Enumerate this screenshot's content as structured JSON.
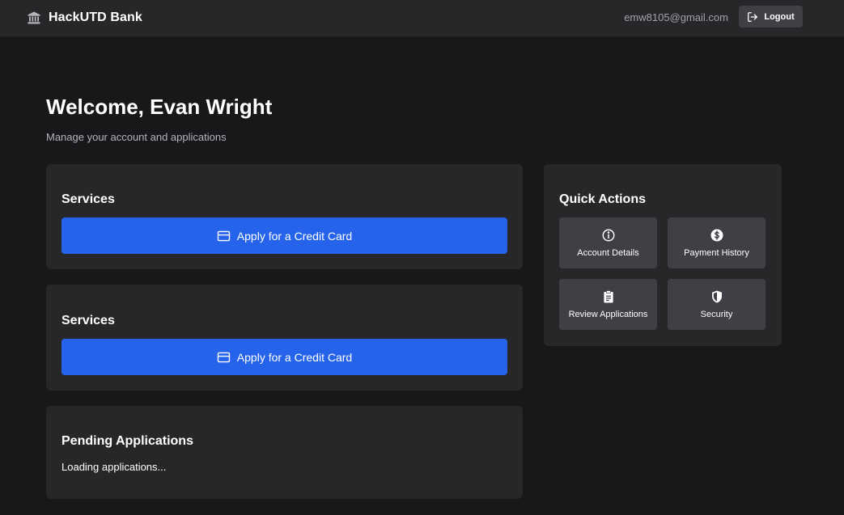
{
  "navbar": {
    "brand": "HackUTD Bank",
    "brand_icon": "bank-icon",
    "user_email": "emw8105@gmail.com",
    "logout_label": "Logout",
    "logout_icon": "logout-icon"
  },
  "header": {
    "title": "Welcome, Evan Wright",
    "subtitle": "Manage your account and applications"
  },
  "services_cards": [
    {
      "title": "Services",
      "button_label": "Apply for a Credit Card",
      "button_icon": "credit-card-icon"
    },
    {
      "title": "Services",
      "button_label": "Apply for a Credit Card",
      "button_icon": "credit-card-icon"
    }
  ],
  "pending": {
    "title": "Pending Applications",
    "status": "Loading applications..."
  },
  "quick_actions": {
    "title": "Quick Actions",
    "items": [
      {
        "label": "Account Details",
        "icon": "info-icon"
      },
      {
        "label": "Payment History",
        "icon": "dollar-icon"
      },
      {
        "label": "Review Applications",
        "icon": "clipboard-icon"
      },
      {
        "label": "Security",
        "icon": "shield-icon"
      }
    ]
  },
  "colors": {
    "background": "#18181b",
    "surface": "#27272a",
    "tile": "#3f3f46",
    "primary": "#2563eb",
    "muted_text": "#a1a1aa"
  }
}
